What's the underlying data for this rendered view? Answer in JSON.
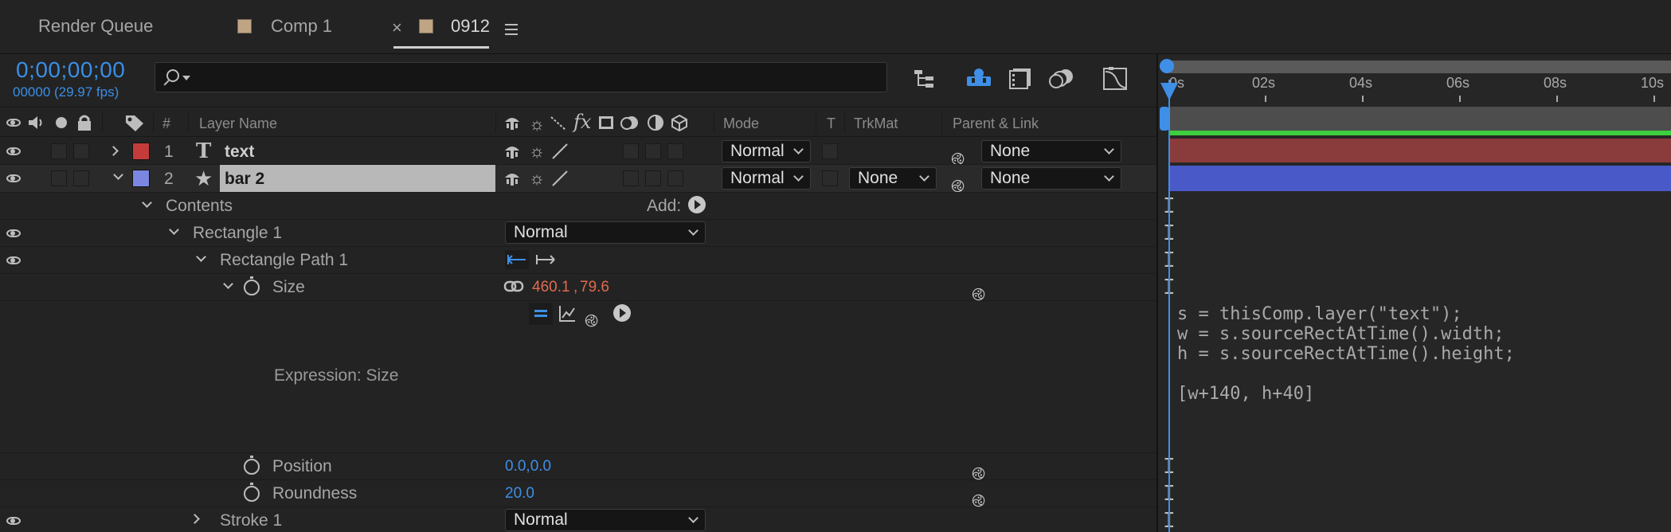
{
  "tabs": [
    {
      "label": "Render Queue"
    },
    {
      "label": "Comp 1"
    },
    {
      "label": "0912"
    }
  ],
  "close_glyph": "×",
  "header": {
    "timecode": "0;00;00;00",
    "frame_fps": "00000 (29.97 fps)",
    "search_placeholder": ""
  },
  "columns": {
    "num": "#",
    "layer_name": "Layer Name",
    "mode": "Mode",
    "t": "T",
    "trkmat": "TrkMat",
    "parent": "Parent & Link"
  },
  "layers": [
    {
      "num": "1",
      "type_glyph": "T",
      "name": "text",
      "color": "#c43b3b",
      "mode": "Normal",
      "trkmat": "",
      "parent": "None"
    },
    {
      "num": "2",
      "type_glyph": "★",
      "name": "bar 2",
      "color": "#7b86e0",
      "mode": "Normal",
      "trkmat": "None",
      "parent": "None"
    }
  ],
  "props": {
    "contents": "Contents",
    "add": "Add:",
    "rect1": "Rectangle 1",
    "rect1_mode": "Normal",
    "rectpath1": "Rectangle Path 1",
    "size": "Size",
    "size_x": "460.1",
    "size_comma": ",",
    "size_y": "79.6",
    "expr_label": "Expression: Size",
    "position": "Position",
    "position_val": "0.0,0.0",
    "roundness": "Roundness",
    "roundness_val": "20.0",
    "stroke1": "Stroke 1",
    "stroke1_mode": "Normal"
  },
  "timeline": {
    "ticks": [
      "0s",
      "02s",
      "04s",
      "06s",
      "08s",
      "10s"
    ],
    "expression": "s = thisComp.layer(\"text\");\nw = s.sourceRectAtTime().width;\nh = s.sourceRectAtTime().height;\n\n[w+140, h+40]"
  },
  "colors": {
    "accent_blue": "#3a8ee6",
    "layer1_bar": "#8a3b3b",
    "layer2_bar": "#4a59c8",
    "work_area": "#3ecf3e",
    "value_red": "#e06b4f"
  }
}
